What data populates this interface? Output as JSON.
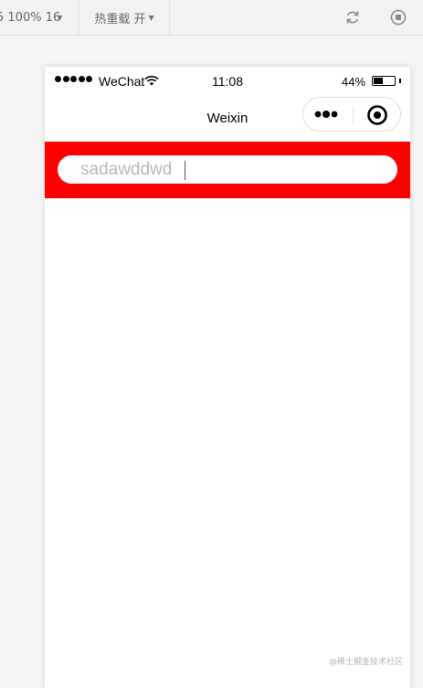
{
  "toolbar": {
    "zoom_label": "5 100% 16",
    "hot_reload_label": "热重载 开",
    "refresh_icon": "refresh-icon",
    "stop_icon": "stop-icon"
  },
  "status_bar": {
    "carrier": "WeChat",
    "time": "11:08",
    "battery_percent": "44%",
    "battery_level": 0.44
  },
  "nav_bar": {
    "title": "Weixin",
    "more_icon": "more-dots-icon",
    "close_icon": "target-close-icon"
  },
  "search": {
    "value": "sadawddwd",
    "background_color": "#ff0000"
  },
  "watermark": "@稀土掘金技术社区"
}
